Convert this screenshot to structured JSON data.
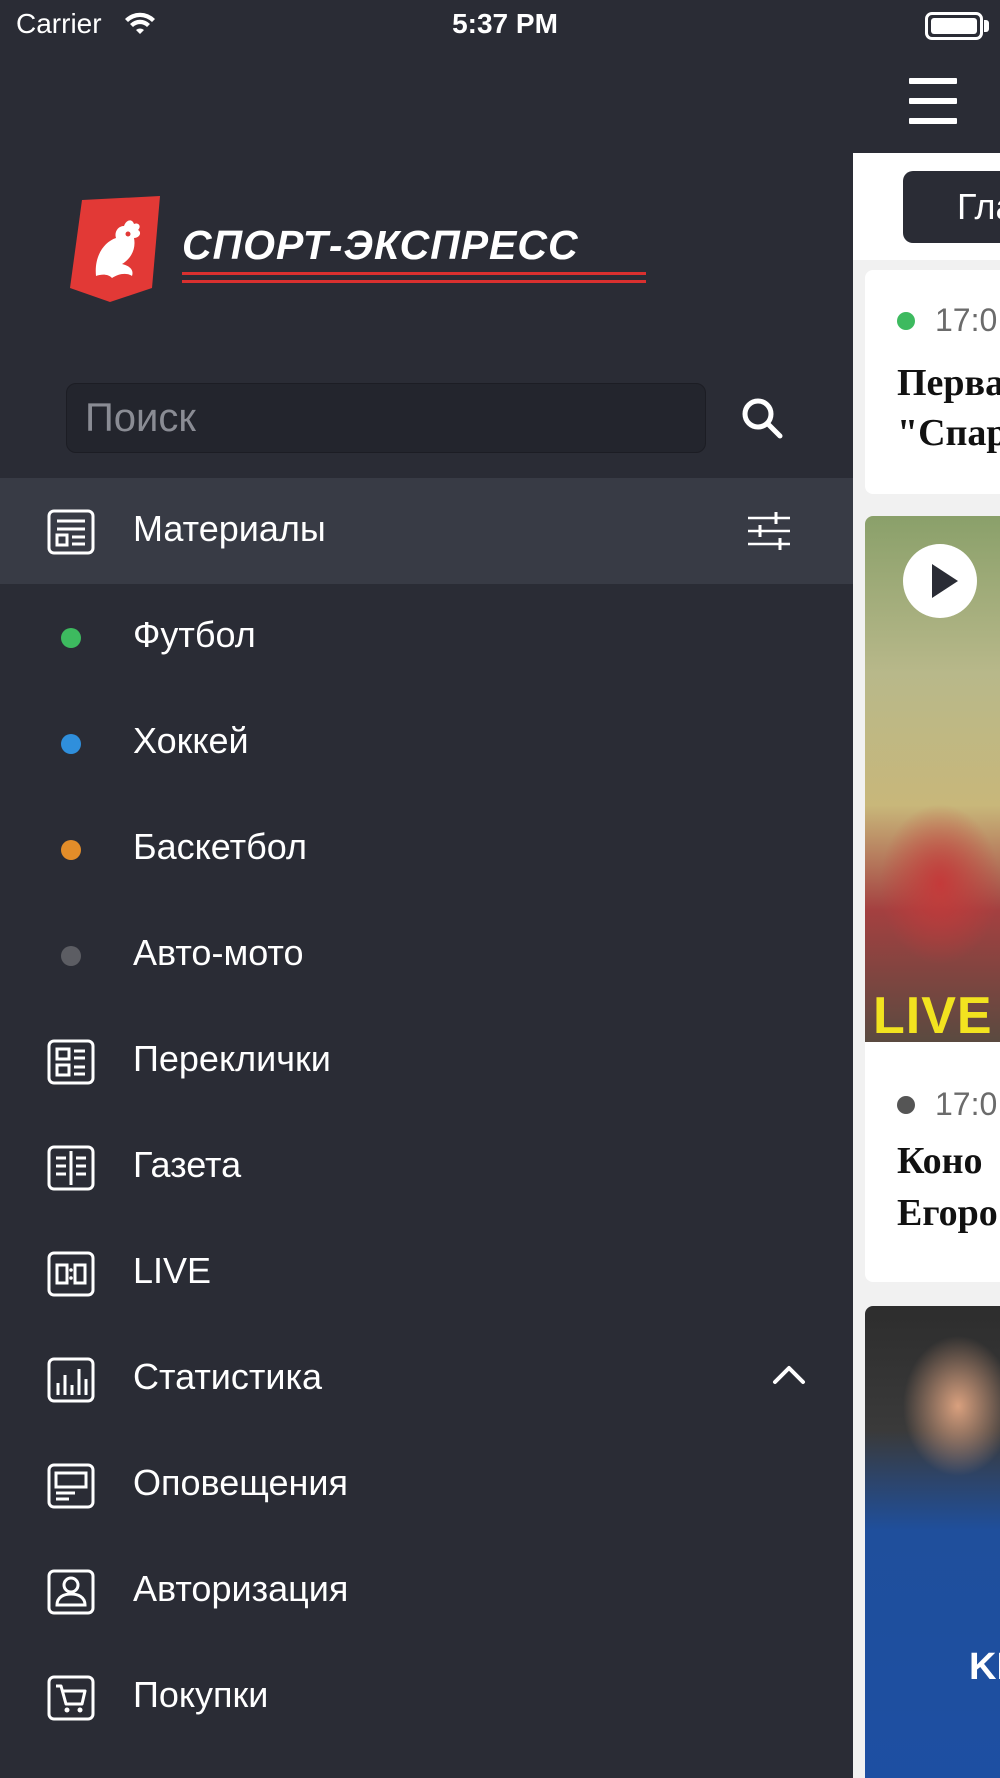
{
  "status_bar": {
    "carrier": "Carrier",
    "time": "5:37 PM"
  },
  "brand": {
    "name": "СПОРТ-ЭКСПРЕСС",
    "accent_color": "#e23936"
  },
  "search": {
    "placeholder": "Поиск"
  },
  "menu": {
    "items": [
      {
        "label": "Материалы",
        "icon": "materials-icon",
        "active": true,
        "trailing": "filter-icon"
      },
      {
        "label": "Футбол",
        "dot_color": "#3dba5f"
      },
      {
        "label": "Хоккей",
        "dot_color": "#2f8fdc"
      },
      {
        "label": "Баскетбол",
        "dot_color": "#e38d29"
      },
      {
        "label": "Авто-мото",
        "dot_color": "#5c5d63"
      },
      {
        "label": "Переклички",
        "icon": "roll-call-icon"
      },
      {
        "label": "Газета",
        "icon": "newspaper-icon"
      },
      {
        "label": "LIVE",
        "icon": "live-score-icon"
      },
      {
        "label": "Статистика",
        "icon": "statistics-icon",
        "trailing": "chevron-up-icon"
      },
      {
        "label": "Оповещения",
        "icon": "notifications-icon"
      },
      {
        "label": "Авторизация",
        "icon": "user-icon"
      },
      {
        "label": "Покупки",
        "icon": "cart-icon"
      }
    ]
  },
  "main": {
    "tab_label": "Гла",
    "cards": [
      {
        "time": "17:0",
        "dot_color": "#3dba5f",
        "title_line1": "Перва",
        "title_line2": "\"Спар"
      },
      {
        "time": "17:0",
        "dot_color": "#555555",
        "title_line1": "Коно",
        "title_line2": "Егоро",
        "badge": "LIVE"
      },
      {
        "jersey_text": "KIN"
      }
    ]
  }
}
